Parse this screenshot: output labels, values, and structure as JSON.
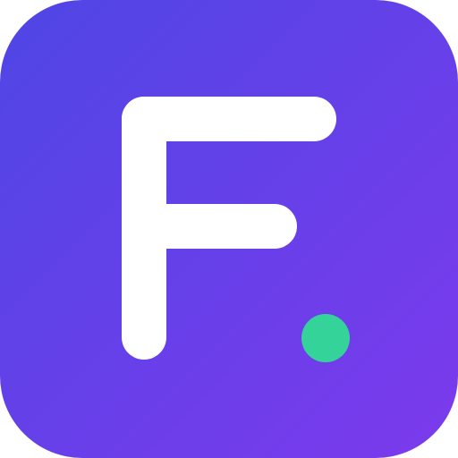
{
  "icon": {
    "name": "f-logo-app-icon",
    "letter": "F",
    "gradient_start": "#4f46e5",
    "gradient_end": "#7c3aed",
    "glyph_color": "#ffffff",
    "dot_color": "#34d399"
  }
}
